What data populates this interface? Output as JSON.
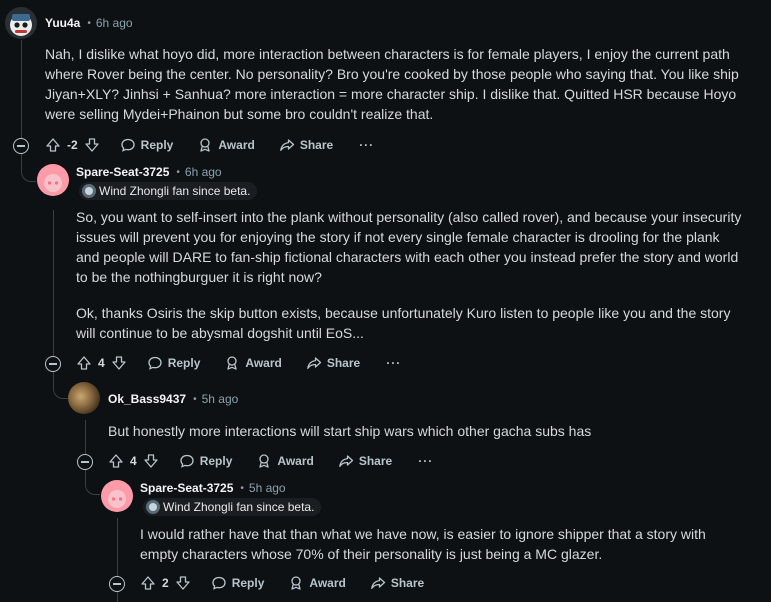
{
  "comments": [
    {
      "author": "Yuu4a",
      "time": "6h ago",
      "body": [
        "Nah, I dislike what hoyo did, more interaction between characters is for female players, I enjoy the current path where Rover being the center. No personality? Bro you're cooked by those people who saying that. You like ship Jiyan+XLY? Jinhsi + Sanhua? more interaction = more character ship. I dislike that. Quitted HSR because Hoyo were selling Mydei+Phainon but some bro couldn't realize that."
      ],
      "score": "-2",
      "reply_label": "Reply",
      "award_label": "Award",
      "share_label": "Share",
      "more_label": "···"
    },
    {
      "author": "Spare-Seat-3725",
      "time": "6h ago",
      "flair": "Wind Zhongli fan since beta.",
      "body": [
        "So, you want to self-insert into the plank without personality (also called rover), and because your insecurity issues will prevent you for enjoying the story if not every single female character is drooling for the plank and people will DARE to fan-ship fictional characters with each other you instead prefer the story and world to be the nothingburguer it is right now?",
        "Ok, thanks Osiris the skip button exists, because unfortunately Kuro listen to people like you and the story will continue to be abysmal dogshit until EoS..."
      ],
      "score": "4",
      "reply_label": "Reply",
      "award_label": "Award",
      "share_label": "Share",
      "more_label": "···"
    },
    {
      "author": "Ok_Bass9437",
      "time": "5h ago",
      "body": [
        "But honestly more interactions will start ship wars which other gacha subs has"
      ],
      "score": "4",
      "reply_label": "Reply",
      "award_label": "Award",
      "share_label": "Share",
      "more_label": "···"
    },
    {
      "author": "Spare-Seat-3725",
      "time": "5h ago",
      "flair": "Wind Zhongli fan since beta.",
      "body": [
        "I would rather have that than what we have now, is easier to ignore shipper that a story with empty characters whose 70% of their personality is just being a MC glazer."
      ],
      "score": "2",
      "reply_label": "Reply",
      "award_label": "Award",
      "share_label": "Share",
      "more_label": "···"
    }
  ],
  "colors": {
    "background": "#0e1113",
    "text": "#d7dadc",
    "muted": "#8ba2ad",
    "thread_line": "#3a3f44",
    "avatar_pink": "#ff9aa8"
  }
}
